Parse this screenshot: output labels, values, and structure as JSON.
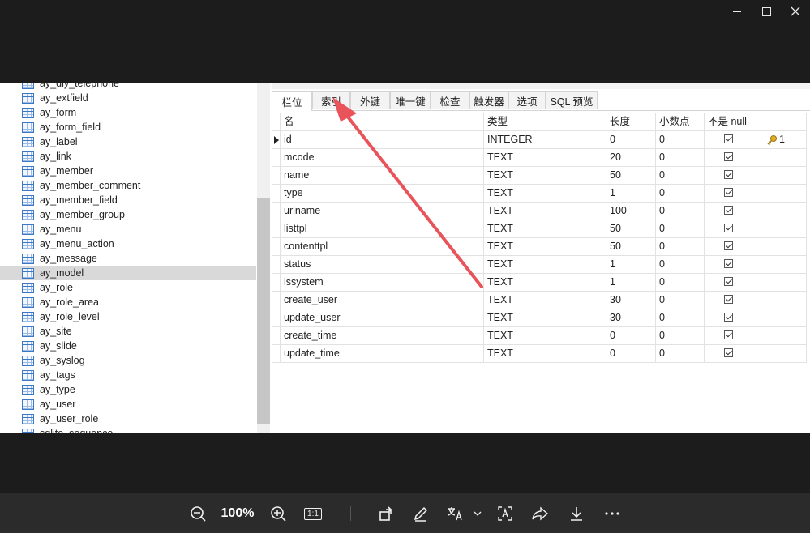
{
  "tree": {
    "items": [
      {
        "label": "ay_diy_telephone",
        "selected": false
      },
      {
        "label": "ay_extfield",
        "selected": false
      },
      {
        "label": "ay_form",
        "selected": false
      },
      {
        "label": "ay_form_field",
        "selected": false
      },
      {
        "label": "ay_label",
        "selected": false
      },
      {
        "label": "ay_link",
        "selected": false
      },
      {
        "label": "ay_member",
        "selected": false
      },
      {
        "label": "ay_member_comment",
        "selected": false
      },
      {
        "label": "ay_member_field",
        "selected": false
      },
      {
        "label": "ay_member_group",
        "selected": false
      },
      {
        "label": "ay_menu",
        "selected": false
      },
      {
        "label": "ay_menu_action",
        "selected": false
      },
      {
        "label": "ay_message",
        "selected": false
      },
      {
        "label": "ay_model",
        "selected": true
      },
      {
        "label": "ay_role",
        "selected": false
      },
      {
        "label": "ay_role_area",
        "selected": false
      },
      {
        "label": "ay_role_level",
        "selected": false
      },
      {
        "label": "ay_site",
        "selected": false
      },
      {
        "label": "ay_slide",
        "selected": false
      },
      {
        "label": "ay_syslog",
        "selected": false
      },
      {
        "label": "ay_tags",
        "selected": false
      },
      {
        "label": "ay_type",
        "selected": false
      },
      {
        "label": "ay_user",
        "selected": false
      },
      {
        "label": "ay_user_role",
        "selected": false
      },
      {
        "label": "sqlite_sequence",
        "selected": false
      }
    ]
  },
  "tabs": [
    {
      "label": "栏位",
      "active": true
    },
    {
      "label": "索引",
      "active": false
    },
    {
      "label": "外键",
      "active": false
    },
    {
      "label": "唯一键",
      "active": false
    },
    {
      "label": "检查",
      "active": false
    },
    {
      "label": "触发器",
      "active": false
    },
    {
      "label": "选项",
      "active": false
    },
    {
      "label": "SQL 预览",
      "active": false
    }
  ],
  "grid": {
    "headers": [
      "名",
      "类型",
      "长度",
      "小数点",
      "不是 null",
      ""
    ],
    "rows": [
      {
        "name": "id",
        "type": "INTEGER",
        "length": "0",
        "decimal": "0",
        "notnull": true,
        "key": "1",
        "current": true
      },
      {
        "name": "mcode",
        "type": "TEXT",
        "length": "20",
        "decimal": "0",
        "notnull": true,
        "key": ""
      },
      {
        "name": "name",
        "type": "TEXT",
        "length": "50",
        "decimal": "0",
        "notnull": true,
        "key": ""
      },
      {
        "name": "type",
        "type": "TEXT",
        "length": "1",
        "decimal": "0",
        "notnull": true,
        "key": ""
      },
      {
        "name": "urlname",
        "type": "TEXT",
        "length": "100",
        "decimal": "0",
        "notnull": true,
        "key": ""
      },
      {
        "name": "listtpl",
        "type": "TEXT",
        "length": "50",
        "decimal": "0",
        "notnull": true,
        "key": ""
      },
      {
        "name": "contenttpl",
        "type": "TEXT",
        "length": "50",
        "decimal": "0",
        "notnull": true,
        "key": ""
      },
      {
        "name": "status",
        "type": "TEXT",
        "length": "1",
        "decimal": "0",
        "notnull": true,
        "key": ""
      },
      {
        "name": "issystem",
        "type": "TEXT",
        "length": "1",
        "decimal": "0",
        "notnull": true,
        "key": ""
      },
      {
        "name": "create_user",
        "type": "TEXT",
        "length": "30",
        "decimal": "0",
        "notnull": true,
        "key": ""
      },
      {
        "name": "update_user",
        "type": "TEXT",
        "length": "30",
        "decimal": "0",
        "notnull": true,
        "key": ""
      },
      {
        "name": "create_time",
        "type": "TEXT",
        "length": "0",
        "decimal": "0",
        "notnull": true,
        "key": ""
      },
      {
        "name": "update_time",
        "type": "TEXT",
        "length": "0",
        "decimal": "0",
        "notnull": true,
        "key": ""
      }
    ]
  },
  "viewer": {
    "zoom": "100%",
    "actual_size_label": "1:1"
  },
  "colors": {
    "annotation": "#e8545a",
    "selection": "#d9d9d9",
    "key": "#e0b020"
  }
}
